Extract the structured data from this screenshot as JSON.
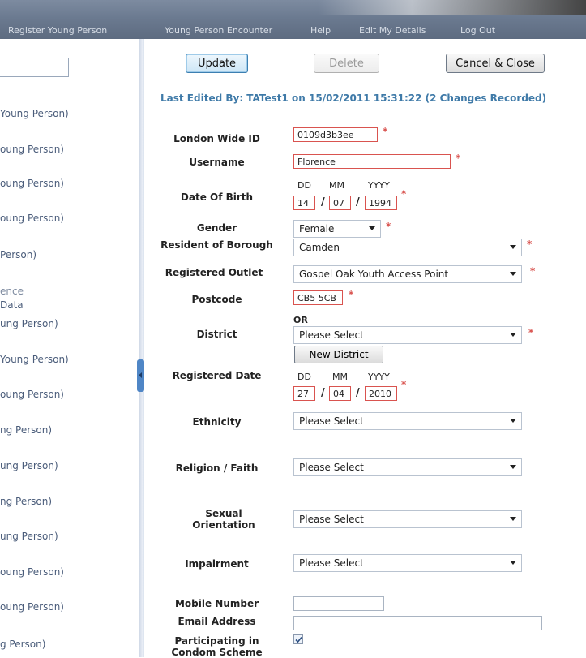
{
  "nav": {
    "items": [
      "Register Young Person",
      "Young Person Encounter",
      "Help",
      "Edit My Details",
      "Log Out"
    ]
  },
  "sidebar": {
    "links": [
      "Young Person)",
      "oung Person)",
      "oung Person)",
      "oung Person)",
      "Person)",
      "ence",
      "Data",
      "ung Person)",
      "Young Person)",
      "oung Person)",
      "ng Person)",
      "ung Person)",
      "ng Person)",
      "ung Person)",
      "oung Person)",
      "oung Person)",
      "g Person)"
    ]
  },
  "toolbar": {
    "update_label": "Update",
    "delete_label": "Delete",
    "cancel_label": "Cancel & Close"
  },
  "last_edited": "Last Edited By: TATest1 on 15/02/2011 15:31:22 (2 Changes Recorded)",
  "form": {
    "london_id": {
      "label": "London Wide ID",
      "value": "0109d3b3ee"
    },
    "username": {
      "label": "Username",
      "value": "Florence"
    },
    "dob": {
      "label": "Date Of Birth",
      "dd_label": "DD",
      "mm_label": "MM",
      "yyyy_label": "YYYY",
      "dd": "14",
      "mm": "07",
      "yyyy": "1994"
    },
    "gender": {
      "label": "Gender",
      "value": "Female"
    },
    "resident": {
      "label": "Resident of Borough",
      "value": "Camden"
    },
    "outlet": {
      "label": "Registered Outlet",
      "value": "Gospel Oak Youth Access Point"
    },
    "postcode": {
      "label": "Postcode",
      "value": "CB5 5CB"
    },
    "or_label": "OR",
    "district": {
      "label": "District",
      "value": "Please Select",
      "new_button": "New District"
    },
    "registered_date": {
      "label": "Registered Date",
      "dd_label": "DD",
      "mm_label": "MM",
      "yyyy_label": "YYYY",
      "dd": "27",
      "mm": "04",
      "yyyy": "2010"
    },
    "ethnicity": {
      "label": "Ethnicity",
      "value": "Please Select"
    },
    "religion": {
      "label": "Religion / Faith",
      "value": "Please Select"
    },
    "orientation": {
      "label": "Sexual Orientation",
      "value": "Please Select"
    },
    "impairment": {
      "label": "Impairment",
      "value": "Please Select"
    },
    "mobile": {
      "label": "Mobile Number",
      "value": ""
    },
    "email": {
      "label": "Email Address",
      "value": ""
    },
    "condom": {
      "label": "Participating in Condom Scheme",
      "checked": true
    }
  },
  "required_marker": "*",
  "colors": {
    "required": "#d9534f",
    "last_edited": "#3f7aa8",
    "nav_bg": "#6b7a90"
  }
}
